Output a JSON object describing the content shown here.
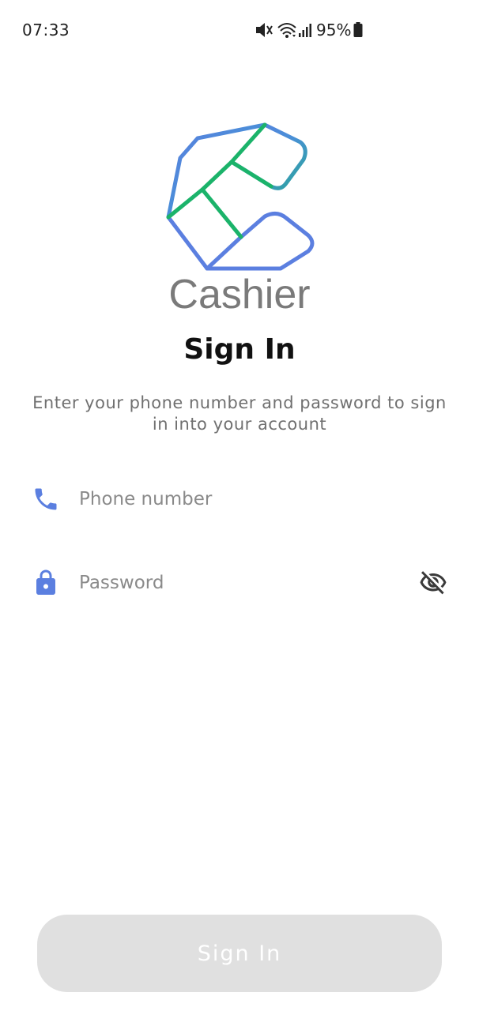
{
  "status_bar": {
    "time": "07:33",
    "battery": "95%",
    "icons": [
      "mute-icon",
      "wifi-icon",
      "signal-icon",
      "battery-icon"
    ]
  },
  "brand": {
    "name": "Cashier",
    "logo": "cashier-logo-icon",
    "colors": {
      "blue": "#5b7fe0",
      "green": "#1bb36a",
      "text": "#7a7a7a"
    }
  },
  "sign_in": {
    "title": "Sign In",
    "subtitle": "Enter your phone number and password to sign in into your account",
    "phone": {
      "placeholder": "Phone number",
      "value": "",
      "icon": "phone-icon"
    },
    "password": {
      "placeholder": "Password",
      "value": "",
      "icon": "lock-icon",
      "toggle_icon": "eye-off-icon"
    },
    "button_label": "Sign In"
  },
  "colors": {
    "accent": "#5b7fe0",
    "button_disabled_bg": "#e0e0e0",
    "button_text": "#ffffff"
  }
}
